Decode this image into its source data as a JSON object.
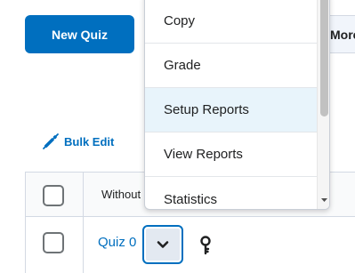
{
  "toolbar": {
    "new_quiz_label": "New Quiz",
    "more_label": "More"
  },
  "bulk_edit": {
    "label": "Bulk Edit",
    "icon": "pencil-icon"
  },
  "table": {
    "header_label": "Without",
    "rows": [
      {
        "link": "Quiz 0"
      }
    ]
  },
  "context_menu": {
    "items": [
      {
        "label": "Copy"
      },
      {
        "label": "Grade"
      },
      {
        "label": "Setup Reports",
        "highlighted": true
      },
      {
        "label": "View Reports"
      },
      {
        "label": "Statistics"
      }
    ]
  },
  "colors": {
    "primary": "#006fbf",
    "highlight": "#e8f4fb",
    "border": "#d3d9e3"
  }
}
